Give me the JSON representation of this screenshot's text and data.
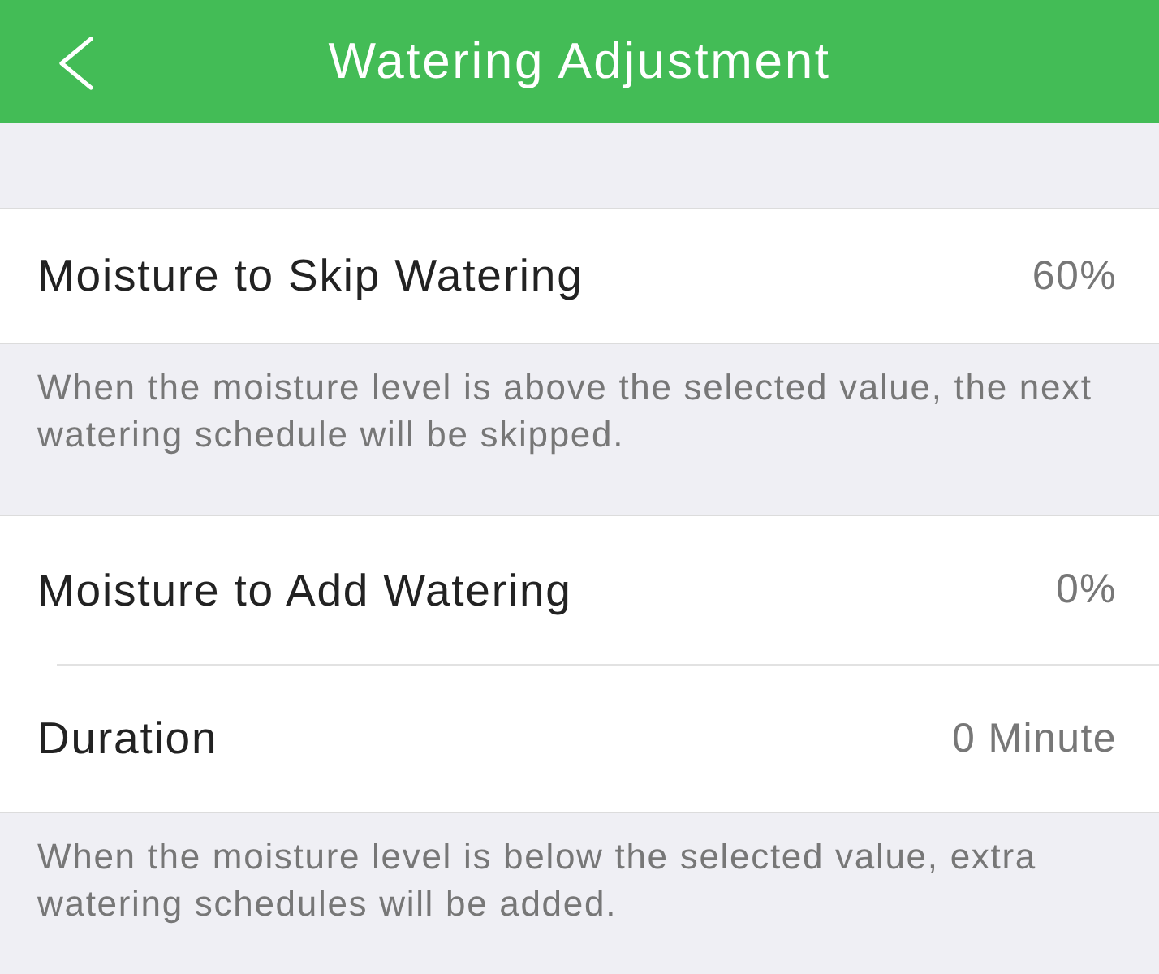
{
  "header": {
    "title": "Watering Adjustment"
  },
  "sections": [
    {
      "rows": [
        {
          "label": "Moisture to Skip Watering",
          "value": "60%"
        }
      ],
      "note": "When the moisture level is above the selected value, the next watering schedule will be skipped."
    },
    {
      "rows": [
        {
          "label": "Moisture to Add Watering",
          "value": "0%"
        },
        {
          "label": "Duration",
          "value": "0 Minute"
        }
      ],
      "note": "When the moisture level is below the selected value, extra watering schedules will be added."
    }
  ]
}
